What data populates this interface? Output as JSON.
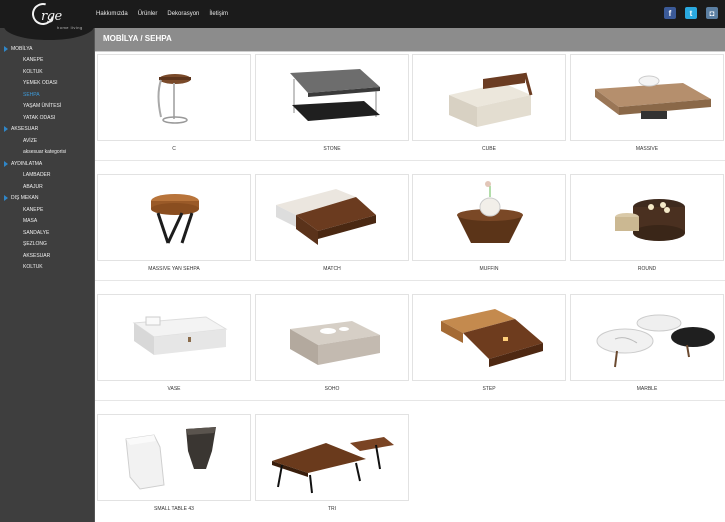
{
  "brand": {
    "logo_text": "rge",
    "logo_sub": "home living"
  },
  "nav": [
    "Hakkımızda",
    "Ürünler",
    "Dekorasyon",
    "İletişim"
  ],
  "social": [
    {
      "name": "facebook-icon",
      "glyph": "f"
    },
    {
      "name": "twitter-icon",
      "glyph": "t"
    },
    {
      "name": "instagram-icon",
      "glyph": "◘"
    }
  ],
  "sidebar": [
    {
      "label": "MOBİLYA",
      "level": "top",
      "arrow": true
    },
    {
      "label": "KANEPE",
      "level": "sub"
    },
    {
      "label": "KOLTUK",
      "level": "sub"
    },
    {
      "label": "YEMEK ODASI",
      "level": "sub"
    },
    {
      "label": "SEHPA",
      "level": "sub",
      "active": true
    },
    {
      "label": "YAŞAM ÜNİTESİ",
      "level": "sub"
    },
    {
      "label": "YATAK ODASI",
      "level": "sub"
    },
    {
      "label": "AKSESUAR",
      "level": "top",
      "arrow": true
    },
    {
      "label": "AVİZE",
      "level": "sub"
    },
    {
      "label": "aksesuar kategorisi",
      "level": "sub"
    },
    {
      "label": "AYDINLATMA",
      "level": "top",
      "arrow": true
    },
    {
      "label": "LAMBADER",
      "level": "sub"
    },
    {
      "label": "ABAJUR",
      "level": "sub"
    },
    {
      "label": "DIŞ MEKAN",
      "level": "top",
      "arrow": true
    },
    {
      "label": "KANEPE",
      "level": "sub"
    },
    {
      "label": "MASA",
      "level": "sub"
    },
    {
      "label": "SANDALYE",
      "level": "sub"
    },
    {
      "label": "ŞEZLONG",
      "level": "sub"
    },
    {
      "label": "AKSESUAR",
      "level": "sub"
    },
    {
      "label": "KOLTUK",
      "level": "sub"
    }
  ],
  "page_title": "MOBİLYA / SEHPA",
  "products": [
    {
      "name": "C"
    },
    {
      "name": "STONE"
    },
    {
      "name": "CUBE"
    },
    {
      "name": "MASSIVE"
    },
    {
      "name": "MASSIVE YAN SEHPA"
    },
    {
      "name": "MATCH"
    },
    {
      "name": "MUFFIN"
    },
    {
      "name": "ROUND"
    },
    {
      "name": "VASE"
    },
    {
      "name": "SOHO"
    },
    {
      "name": "STEP"
    },
    {
      "name": "MARBLE"
    },
    {
      "name": "SMALL TABLE 43"
    },
    {
      "name": "TRI"
    }
  ]
}
